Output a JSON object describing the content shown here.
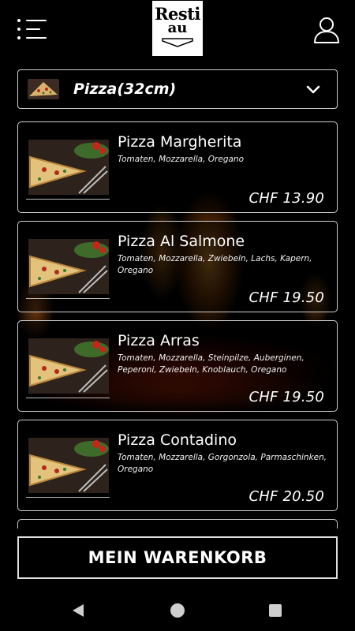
{
  "header": {
    "logo_line1": "Resti",
    "logo_line2": "au",
    "menu_icon": "hamburger-list-icon",
    "user_icon": "user-icon"
  },
  "category": {
    "label": "Pizza(32cm)",
    "icon": "chevron-down-icon"
  },
  "products": [
    {
      "name": "Pizza Margherita",
      "description": "Tomaten, Mozzarella, Oregano",
      "price": "CHF 13.90"
    },
    {
      "name": "Pizza Al Salmone",
      "description": "Tomaten, Mozzarella, Zwiebeln, Lachs, Kapern, Oregano",
      "price": "CHF 19.50"
    },
    {
      "name": "Pizza Arras",
      "description": "Tomaten, Mozzarella, Steinpilze, Auberginen, Peperoni, Zwiebeln, Knoblauch, Oregano",
      "price": "CHF 19.50"
    },
    {
      "name": "Pizza Contadino",
      "description": "Tomaten, Mozzarella, Gorgonzola, Parmaschinken, Oregano",
      "price": "CHF 20.50"
    }
  ],
  "cart": {
    "label": "MEIN WARENKORB"
  },
  "colors": {
    "background": "#000000",
    "text": "#ffffff",
    "border": "#cfcfcf"
  }
}
